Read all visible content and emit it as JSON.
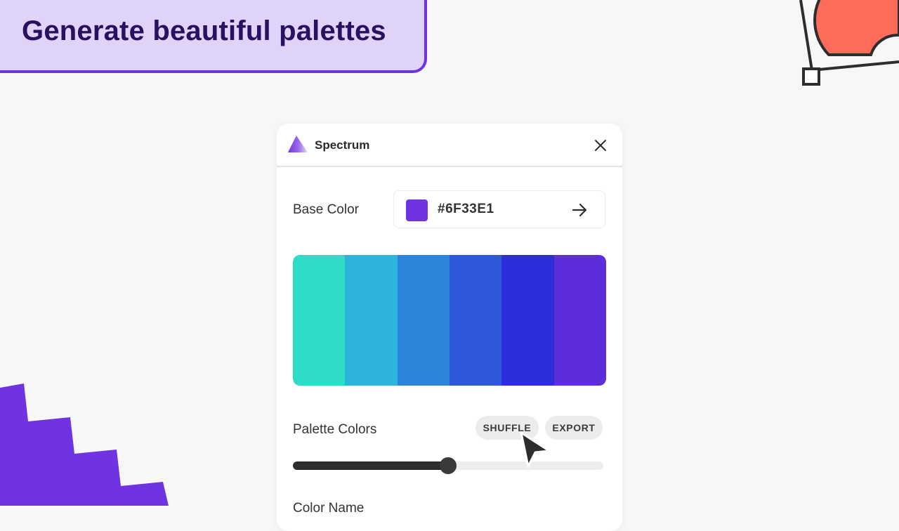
{
  "banner": {
    "text": "Generate beautiful palettes"
  },
  "app": {
    "title": "Spectrum",
    "logo_icon": "triangle-gradient-icon",
    "close_icon": "close-icon"
  },
  "base_color": {
    "label": "Base Color",
    "value": "#6F33E1",
    "swatch": "#6f33e1",
    "submit_icon": "arrow-right-icon"
  },
  "palette": {
    "colors": [
      "#2fdcc8",
      "#2db4dc",
      "#2d85db",
      "#2d58da",
      "#2d2ddb",
      "#5e2ddb"
    ]
  },
  "palette_colors": {
    "label": "Palette Colors",
    "shuffle_label": "SHUFFLE",
    "export_label": "EXPORT",
    "slider_fraction": 0.5
  },
  "next_section": {
    "label": "Color Name"
  },
  "colors": {
    "accent": "#6f33e1",
    "banner_bg": "#e0d3f8",
    "decor_coral": "#ff6b5a"
  }
}
